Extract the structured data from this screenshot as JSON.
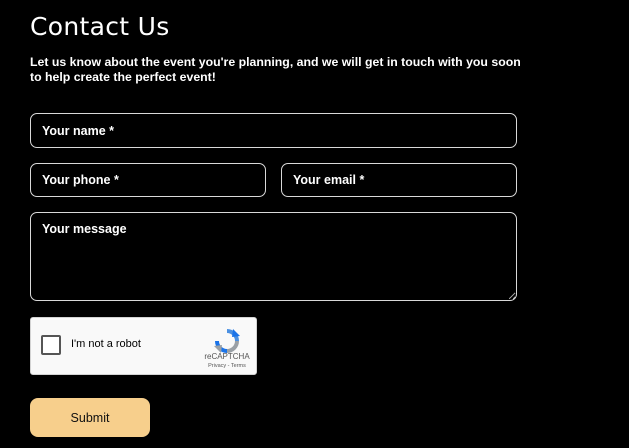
{
  "page": {
    "title": "Contact Us",
    "intro": "Let us know about the event you're planning, and we will get in touch with you soon to help create the perfect event!"
  },
  "form": {
    "name_placeholder": "Your name *",
    "phone_placeholder": "Your phone *",
    "email_placeholder": "Your email *",
    "message_placeholder": "Your message",
    "submit_label": "Submit"
  },
  "recaptcha": {
    "label": "I'm not a robot",
    "brand": "reCAPTCHA",
    "privacy": "Privacy",
    "separator": " - ",
    "terms": "Terms",
    "checked": false,
    "icon": "recaptcha-logo-icon"
  },
  "colors": {
    "background": "#000000",
    "text": "#ffffff",
    "field_border": "#d9d9d9",
    "submit_background": "#f7cf8c",
    "recaptcha_blue": "#4a90e2",
    "recaptcha_gray": "#9aa0a6"
  }
}
